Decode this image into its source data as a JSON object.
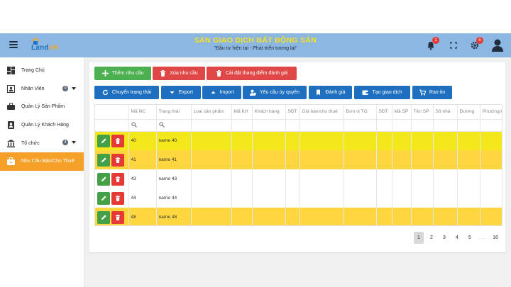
{
  "header": {
    "title": "SÀN GIAO DỊCH BẤT ĐỘNG SẢN",
    "subtitle": "\"Đầu tư hiện tại - Phát triển tương lai\"",
    "logo_text_main": "Land",
    "logo_text_accent": "nH",
    "notification_count": "1",
    "settings_count": "5"
  },
  "sidebar": {
    "items": [
      {
        "label": "Trang Chủ",
        "icon": "dashboard-icon"
      },
      {
        "label": "Nhân Viên",
        "icon": "id-card-icon",
        "count": "0",
        "expandable": true
      },
      {
        "label": "Quản Lý Sản Phẩm",
        "icon": "briefcase-icon"
      },
      {
        "label": "Quản Lý Khách Hàng",
        "icon": "contact-icon"
      },
      {
        "label": "Tổ chức",
        "icon": "bank-icon",
        "count": "4",
        "expandable": true
      },
      {
        "label": "Nhu Cầu Bán/Cho Thuê",
        "icon": "bag-icon",
        "active": true
      }
    ]
  },
  "toolbar": {
    "add_label": "Thêm nhu cầu",
    "delete_label": "Xóa nhu cầu",
    "rating_label": "Cài đặt thang điểm đánh giá",
    "change_status_label": "Chuyển trạng thái",
    "export_label": "Export",
    "import_label": "Import",
    "authorize_label": "Yêu cầu ủy quyền",
    "review_label": "Đánh giá",
    "create_deal_label": "Tạo giao dịch",
    "post_label": "Rao tin"
  },
  "table": {
    "columns": [
      "",
      "Mã NC",
      "Trạng thái",
      "Loại sản phẩm",
      "Mã KH",
      "Khách hàng",
      "SĐT",
      "Giá bán/cho thuê",
      "Đơn vị TG",
      "SĐT",
      "Mã SP",
      "Tên SP",
      "Số nhà",
      "Đường",
      "Phường/xã"
    ],
    "rows": [
      {
        "id": "40",
        "status": "name 40",
        "color": "yellow"
      },
      {
        "id": "41",
        "status": "name 41",
        "color": "gold"
      },
      {
        "id": "43",
        "status": "name 43",
        "color": "white"
      },
      {
        "id": "44",
        "status": "name 44",
        "color": "white"
      },
      {
        "id": "48",
        "status": "name 48",
        "color": "gold"
      }
    ]
  },
  "pagination": {
    "pages": [
      "1",
      "2",
      "3",
      "4",
      "5"
    ],
    "ellipsis": ". . .",
    "last": "16",
    "current": "1"
  },
  "colors": {
    "header_bg": "#8cb7e3",
    "title": "#f7e11a",
    "active_sidebar": "#f5a028",
    "green": "#4caf50",
    "red": "#e04848",
    "blue": "#1e6fc0",
    "row_yellow": "#f2e81c",
    "row_gold": "#fdd640"
  }
}
